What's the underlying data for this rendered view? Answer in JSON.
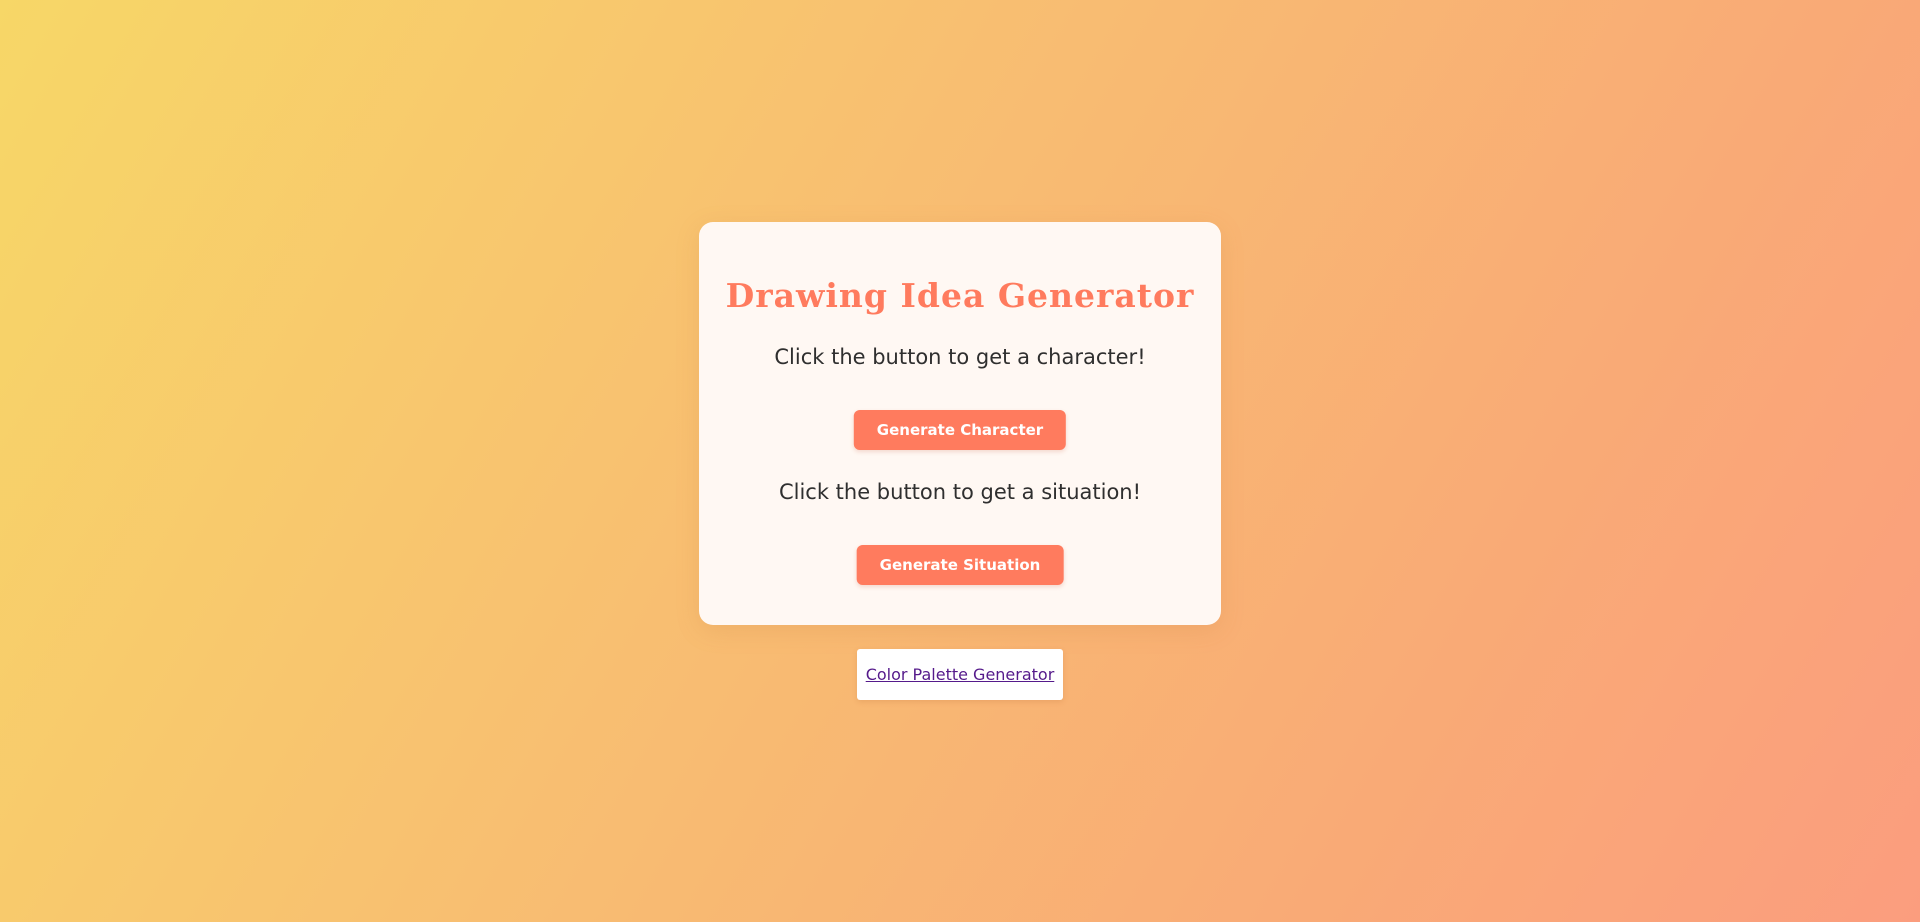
{
  "page": {
    "background_gradient": [
      "#f7d767",
      "#f8bf71",
      "#f9aa76",
      "#fb9d7e"
    ]
  },
  "card": {
    "title": "Drawing Idea Generator",
    "character_prompt": "Click the button to get a character!",
    "character_button_label": "Generate Character",
    "situation_prompt": "Click the button to get a situation!",
    "situation_button_label": "Generate Situation"
  },
  "footer": {
    "link_label": "Color Palette Generator"
  },
  "colors": {
    "accent": "#ff7b5e",
    "card_background": "#fff8f3",
    "text": "#2f2f2f",
    "visited_link": "#551a8b"
  }
}
